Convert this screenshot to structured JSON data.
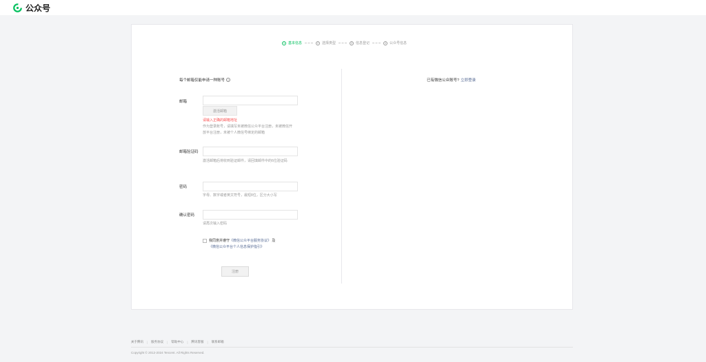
{
  "header": {
    "brand": "公众号",
    "logo_icon": "wechat-official-account-logo-icon",
    "brand_color": "#07c160"
  },
  "steps": [
    {
      "number": "1",
      "label": "基本信息",
      "active": true
    },
    {
      "number": "2",
      "label": "选择类型",
      "active": false
    },
    {
      "number": "3",
      "label": "信息登记",
      "active": false
    },
    {
      "number": "4",
      "label": "公众号信息",
      "active": false
    }
  ],
  "form": {
    "heading": "每个邮箱仅能申请一种账号",
    "help_icon": "question-circle-icon",
    "email": {
      "label": "邮箱",
      "value": "",
      "placeholder": "",
      "activate_button": "激活邮箱",
      "error": "请输入正确的邮箱地址",
      "hint": "作为登录账号，请填写未被微信公众平台注册，未被微信开放平台注册，未被个人微信号绑定的邮箱"
    },
    "verify_code": {
      "label": "邮箱验证码",
      "value": "",
      "hint": "激活邮箱后将收到验证邮件，请回填邮件中的6位验证码"
    },
    "password": {
      "label": "密码",
      "value": "",
      "hint": "字母、数字或者英文符号，最短8位，区分大小写"
    },
    "confirm_password": {
      "label": "确认密码",
      "value": "",
      "hint": "请再次输入密码"
    },
    "agreement": {
      "prefix": "我同意并遵守",
      "link1": "《微信公众平台服务协议》",
      "middle": " 及 ",
      "link2": "《微信公众平台个人信息保护指引》",
      "checked": false
    },
    "register_button": "注册"
  },
  "login_hint": {
    "text": "已有微信公众账号?",
    "link": "立即登录"
  },
  "footer": {
    "links": [
      "关于腾讯",
      "服务协议",
      "帮助中心",
      "腾讯客服",
      "联系邮箱"
    ],
    "copyright": "Copyright © 2012-2024 Tencent. All Rights Reserved."
  },
  "colors": {
    "accent": "#07c160",
    "link": "#576b95",
    "error": "#fa5151"
  }
}
